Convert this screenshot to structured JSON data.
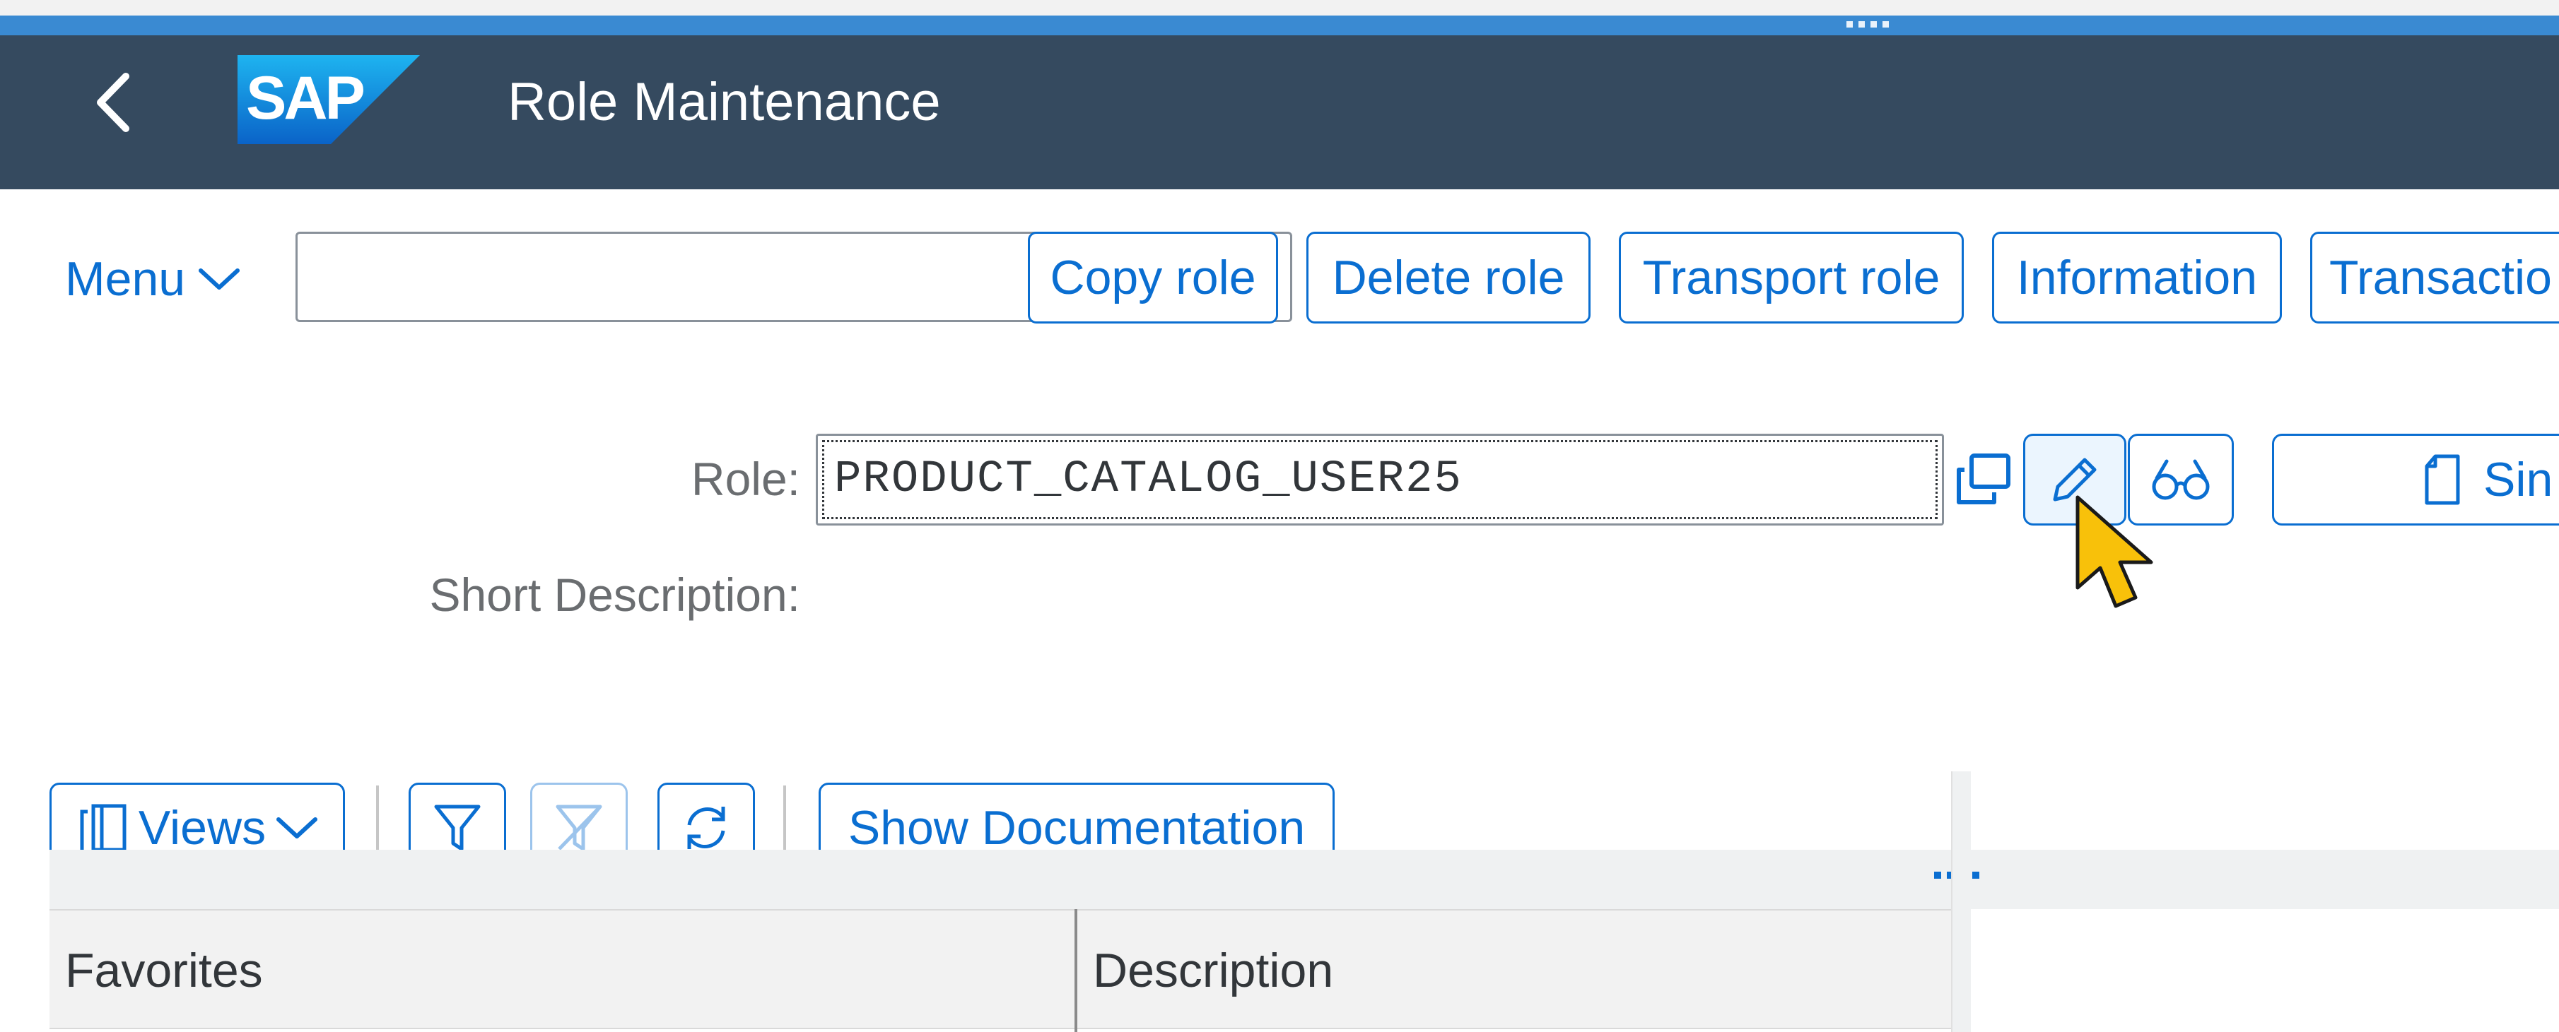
{
  "shell": {
    "title": "Role Maintenance",
    "logo_text": "SAP",
    "icons": {
      "back": "chevron-left-icon"
    }
  },
  "toolbar": {
    "menu_label": "Menu",
    "command_field_value": "",
    "buttons": [
      "Copy role",
      "Delete role",
      "Transport role",
      "Information",
      "Transactio"
    ]
  },
  "form": {
    "role_label": "Role:",
    "role_value": "PRODUCT_CATALOG_USER25",
    "short_description_label": "Short Description:",
    "single_role_button_label": "Sin",
    "icons": {
      "copy": "copy-icon",
      "change": "pencil-icon",
      "display": "glasses-icon",
      "single": "document-icon"
    }
  },
  "tree_toolbar": {
    "views_label": "Views",
    "show_documentation_label": "Show Documentation",
    "icons": {
      "views": "views-icon",
      "filter": "filter-icon",
      "filter_disabled": "filter-delete-icon",
      "refresh": "refresh-icon"
    }
  },
  "table": {
    "columns": [
      "Favorites",
      "Description"
    ]
  },
  "colors": {
    "shell_bg": "#354a5f",
    "accent_strip": "#3a8ad2",
    "brand_blue": "#0a6ed1",
    "cursor_fill": "#f8c10a"
  }
}
